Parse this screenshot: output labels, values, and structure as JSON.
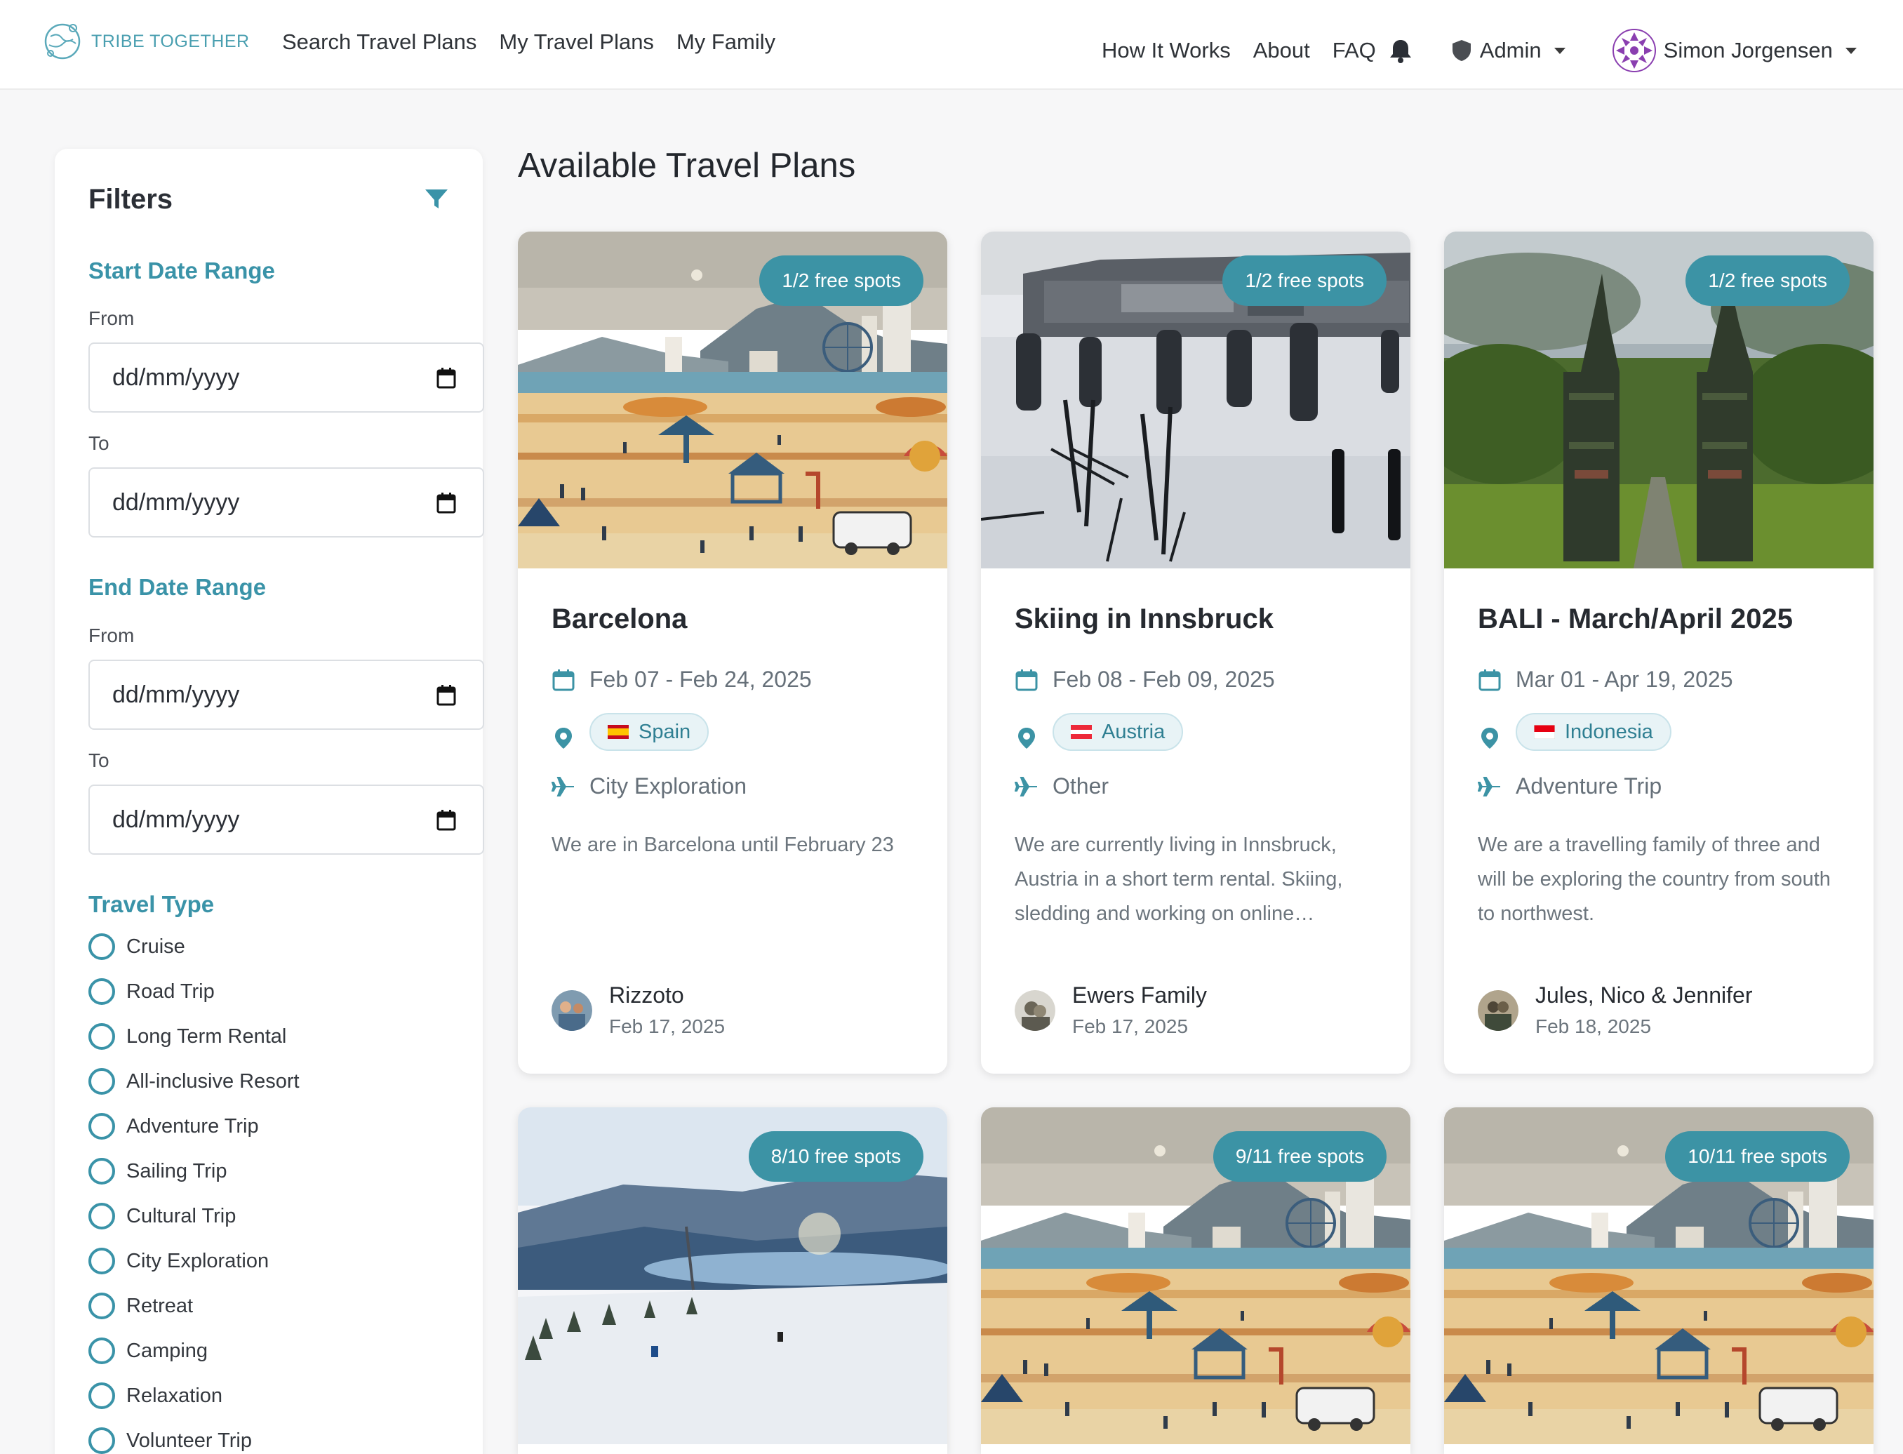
{
  "nav": {
    "brand": "TRIBE TOGETHER",
    "links_left": [
      "Search Travel Plans",
      "My Travel Plans",
      "My Family"
    ],
    "links_right": [
      "How It Works",
      "About",
      "FAQ"
    ],
    "admin_label": "Admin",
    "user_name": "Simon Jorgensen"
  },
  "filters": {
    "title": "Filters",
    "start_range": {
      "title": "Start Date Range",
      "from_label": "From",
      "to_label": "To",
      "from_value": "dd/mm/yyyy",
      "to_value": "dd/mm/yyyy"
    },
    "end_range": {
      "title": "End Date Range",
      "from_label": "From",
      "to_label": "To",
      "from_value": "dd/mm/yyyy",
      "to_value": "dd/mm/yyyy"
    },
    "travel_type": {
      "title": "Travel Type",
      "options": [
        "Cruise",
        "Road Trip",
        "Long Term Rental",
        "All-inclusive Resort",
        "Adventure Trip",
        "Sailing Trip",
        "Cultural Trip",
        "City Exploration",
        "Retreat",
        "Camping",
        "Relaxation",
        "Volunteer Trip"
      ]
    }
  },
  "main": {
    "title": "Available Travel Plans",
    "cards": [
      {
        "badge": "1/2 free spots",
        "title": "Barcelona",
        "dates": "Feb 07 - Feb 24, 2025",
        "country": "Spain",
        "type": "City Exploration",
        "description": "We are in Barcelona until February 23",
        "owner": "Rizzoto",
        "posted": "Feb 17, 2025",
        "image": "beach-illustration"
      },
      {
        "badge": "1/2 free spots",
        "title": "Skiing in Innsbruck",
        "dates": "Feb 08 - Feb 09, 2025",
        "country": "Austria",
        "type": "Other",
        "description": "We are currently living in Innsbruck, Austria in a short term rental. Skiing, sledding and working on online…",
        "owner": "Ewers Family",
        "posted": "Feb 17, 2025",
        "image": "ski-photo"
      },
      {
        "badge": "1/2 free spots",
        "title": "BALI - March/April 2025",
        "dates": "Mar 01 - Apr 19, 2025",
        "country": "Indonesia",
        "type": "Adventure Trip",
        "description": "We are a travelling family of three and will be exploring the country from south to northwest.",
        "owner": "Jules, Nico & Jennifer",
        "posted": "Feb 18, 2025",
        "image": "temple-gate-photo"
      },
      {
        "badge": "8/10 free spots",
        "image": "snow-slope-photo"
      },
      {
        "badge": "9/11 free spots",
        "image": "beach-illustration"
      },
      {
        "badge": "10/11 free spots",
        "image": "beach-illustration"
      }
    ]
  },
  "colors": {
    "accent": "#3c93a5",
    "brand": "#4a9fb0",
    "background": "#f7f7f8"
  }
}
